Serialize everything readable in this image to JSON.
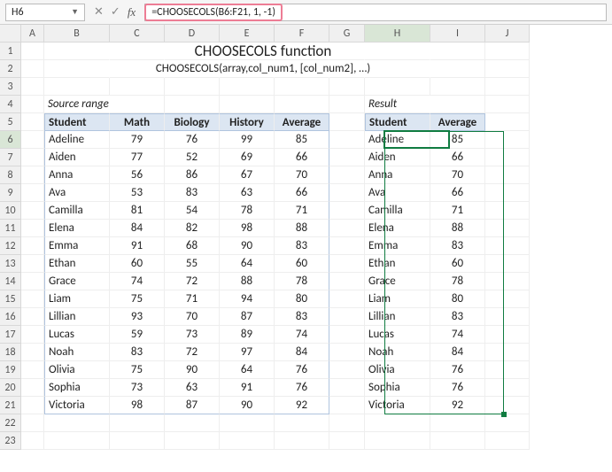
{
  "nameBox": "H6",
  "formula": "=CHOOSECOLS(B6:F21, 1, -1)",
  "colHeaders": [
    "A",
    "B",
    "C",
    "D",
    "E",
    "F",
    "G",
    "H",
    "I",
    "J"
  ],
  "rowHeaders": [
    "1",
    "2",
    "3",
    "4",
    "5",
    "6",
    "7",
    "8",
    "9",
    "10",
    "11",
    "12",
    "13",
    "14",
    "15",
    "16",
    "17",
    "18",
    "19",
    "20",
    "21",
    "22",
    "23"
  ],
  "title": "CHOOSECOLS function",
  "subtitle": "CHOOSECOLS(array,col_num1, [col_num2], …)",
  "sourceLabel": "Source range",
  "resultLabel": "Result",
  "src": {
    "headers": [
      "Student",
      "Math",
      "Biology",
      "History",
      "Average"
    ],
    "rows": [
      [
        "Adeline",
        "79",
        "76",
        "99",
        "85"
      ],
      [
        "Aiden",
        "77",
        "52",
        "69",
        "66"
      ],
      [
        "Anna",
        "56",
        "86",
        "67",
        "70"
      ],
      [
        "Ava",
        "53",
        "83",
        "63",
        "66"
      ],
      [
        "Camilla",
        "81",
        "54",
        "78",
        "71"
      ],
      [
        "Elena",
        "84",
        "82",
        "98",
        "88"
      ],
      [
        "Emma",
        "91",
        "68",
        "90",
        "83"
      ],
      [
        "Ethan",
        "60",
        "55",
        "64",
        "60"
      ],
      [
        "Grace",
        "74",
        "72",
        "88",
        "78"
      ],
      [
        "Liam",
        "75",
        "71",
        "94",
        "80"
      ],
      [
        "Lillian",
        "93",
        "70",
        "87",
        "83"
      ],
      [
        "Lucas",
        "59",
        "73",
        "89",
        "74"
      ],
      [
        "Noah",
        "83",
        "72",
        "97",
        "84"
      ],
      [
        "Olivia",
        "75",
        "90",
        "64",
        "76"
      ],
      [
        "Sophia",
        "73",
        "63",
        "91",
        "76"
      ],
      [
        "Victoria",
        "98",
        "87",
        "90",
        "92"
      ]
    ]
  },
  "res": {
    "headers": [
      "Student",
      "Average"
    ],
    "rows": [
      [
        "Adeline",
        "85"
      ],
      [
        "Aiden",
        "66"
      ],
      [
        "Anna",
        "70"
      ],
      [
        "Ava",
        "66"
      ],
      [
        "Camilla",
        "71"
      ],
      [
        "Elena",
        "88"
      ],
      [
        "Emma",
        "83"
      ],
      [
        "Ethan",
        "60"
      ],
      [
        "Grace",
        "78"
      ],
      [
        "Liam",
        "80"
      ],
      [
        "Lillian",
        "83"
      ],
      [
        "Lucas",
        "74"
      ],
      [
        "Noah",
        "84"
      ],
      [
        "Olivia",
        "76"
      ],
      [
        "Sophia",
        "76"
      ],
      [
        "Victoria",
        "92"
      ]
    ]
  },
  "icons": {
    "dropdown": "▼",
    "cancel": "✕",
    "confirm": "✓"
  }
}
